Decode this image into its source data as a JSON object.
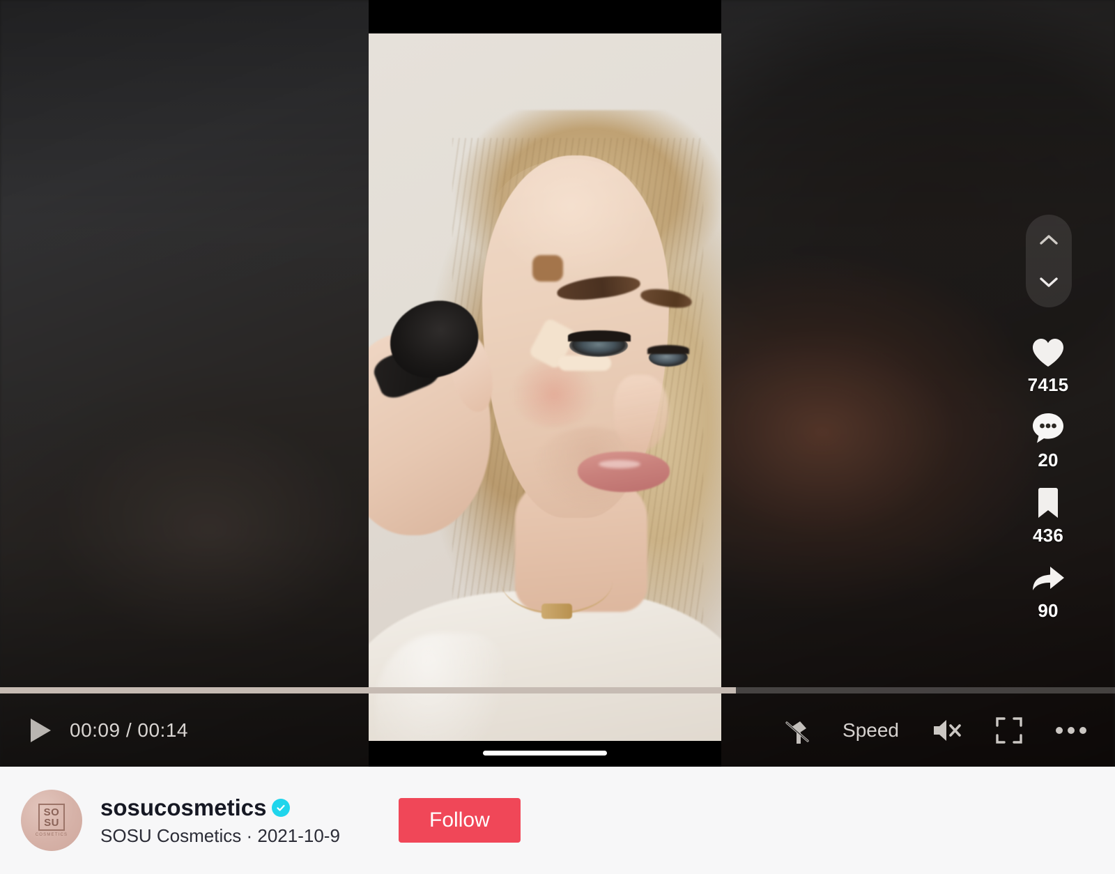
{
  "player": {
    "time_current": "00:09",
    "time_total": "00:14",
    "time_display": "00:09 / 00:14",
    "progress_percent": 66,
    "play_state": "paused",
    "play_icon": "play-icon",
    "speed_label": "Speed",
    "mute_state": "muted",
    "mute_icon": "speaker-muted-icon",
    "fullscreen_icon": "fullscreen-icon",
    "more_icon": "more-options-icon",
    "clear_mode_icon": "clear-mode-off-icon",
    "nav_up_icon": "chevron-up-icon",
    "nav_down_icon": "chevron-down-icon"
  },
  "actions": [
    {
      "name": "like",
      "icon": "heart-icon",
      "count": "7415"
    },
    {
      "name": "comment",
      "icon": "comment-bubble-icon",
      "count": "20"
    },
    {
      "name": "bookmark",
      "icon": "bookmark-icon",
      "count": "436"
    },
    {
      "name": "share",
      "icon": "share-arrow-icon",
      "count": "90"
    }
  ],
  "author": {
    "username": "sosucosmetics",
    "display_name": "SOSU Cosmetics",
    "separator": "·",
    "date": "2021-10-9",
    "meta_line": "SOSU Cosmetics · 2021-10-9",
    "verified": true,
    "follow_label": "Follow",
    "avatar_text_top": "SO",
    "avatar_text_bottom": "SU",
    "avatar_subtext": "COSMETICS"
  },
  "colors": {
    "accent_follow": "#f04758",
    "verified_badge": "#20d5ec",
    "progress_fill": "#c6bbb3",
    "footer_bg": "#f7f7f8",
    "control_text": "#d9d5d2"
  }
}
